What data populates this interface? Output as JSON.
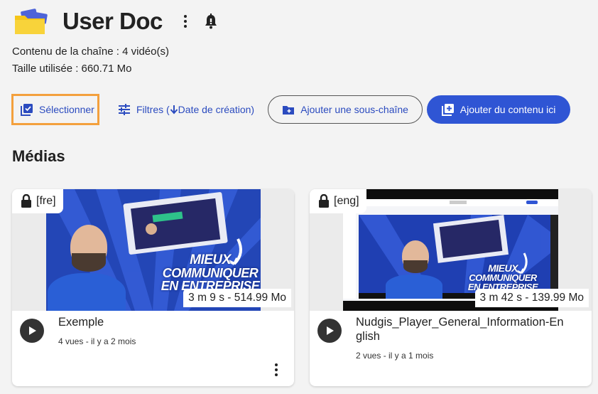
{
  "channel": {
    "title": "User Doc",
    "content_line": "Contenu de la chaîne :  4 vidéo(s)",
    "size_line": "Taille utilisée : 660.71 Mo"
  },
  "toolbar": {
    "select_label": "Sélectionner",
    "filters_label": "Filtres (",
    "filters_sort": " Date de création)",
    "add_subchannel_label": "Ajouter une sous-chaîne",
    "add_content_label": "Ajouter du contenu ici"
  },
  "section_title": "Médias",
  "videos": [
    {
      "lang": "[fre]",
      "duration": "3 m 9 s - 514.99 Mo",
      "title": "Exemple",
      "stats": "4 vues  - il y a 2 mois",
      "thumb_text_1": "MIEUX",
      "thumb_text_2": "COMMUNIQUER",
      "thumb_text_3": "EN ENTREPRISE"
    },
    {
      "lang": "[eng]",
      "duration": "3 m 42 s - 139.99 Mo",
      "title": "Nudgis_Player_General_Information-English",
      "stats": "2 vues  - il y a 1 mois",
      "thumb_text_1": "MIEUX",
      "thumb_text_2": "COMMUNIQUER",
      "thumb_text_3": "EN ENTREPRISE"
    }
  ],
  "colors": {
    "accent": "#2f55d4",
    "link": "#2b4bbf",
    "focus_outline": "#f3a03d",
    "background": "#f3f3f3"
  },
  "icons": [
    "folder-icon",
    "kebab-icon",
    "bell-icon",
    "select-checkbox-icon",
    "filter-icon",
    "arrow-down-icon",
    "add-folder-icon",
    "add-content-icon",
    "lock-icon",
    "play-icon"
  ]
}
